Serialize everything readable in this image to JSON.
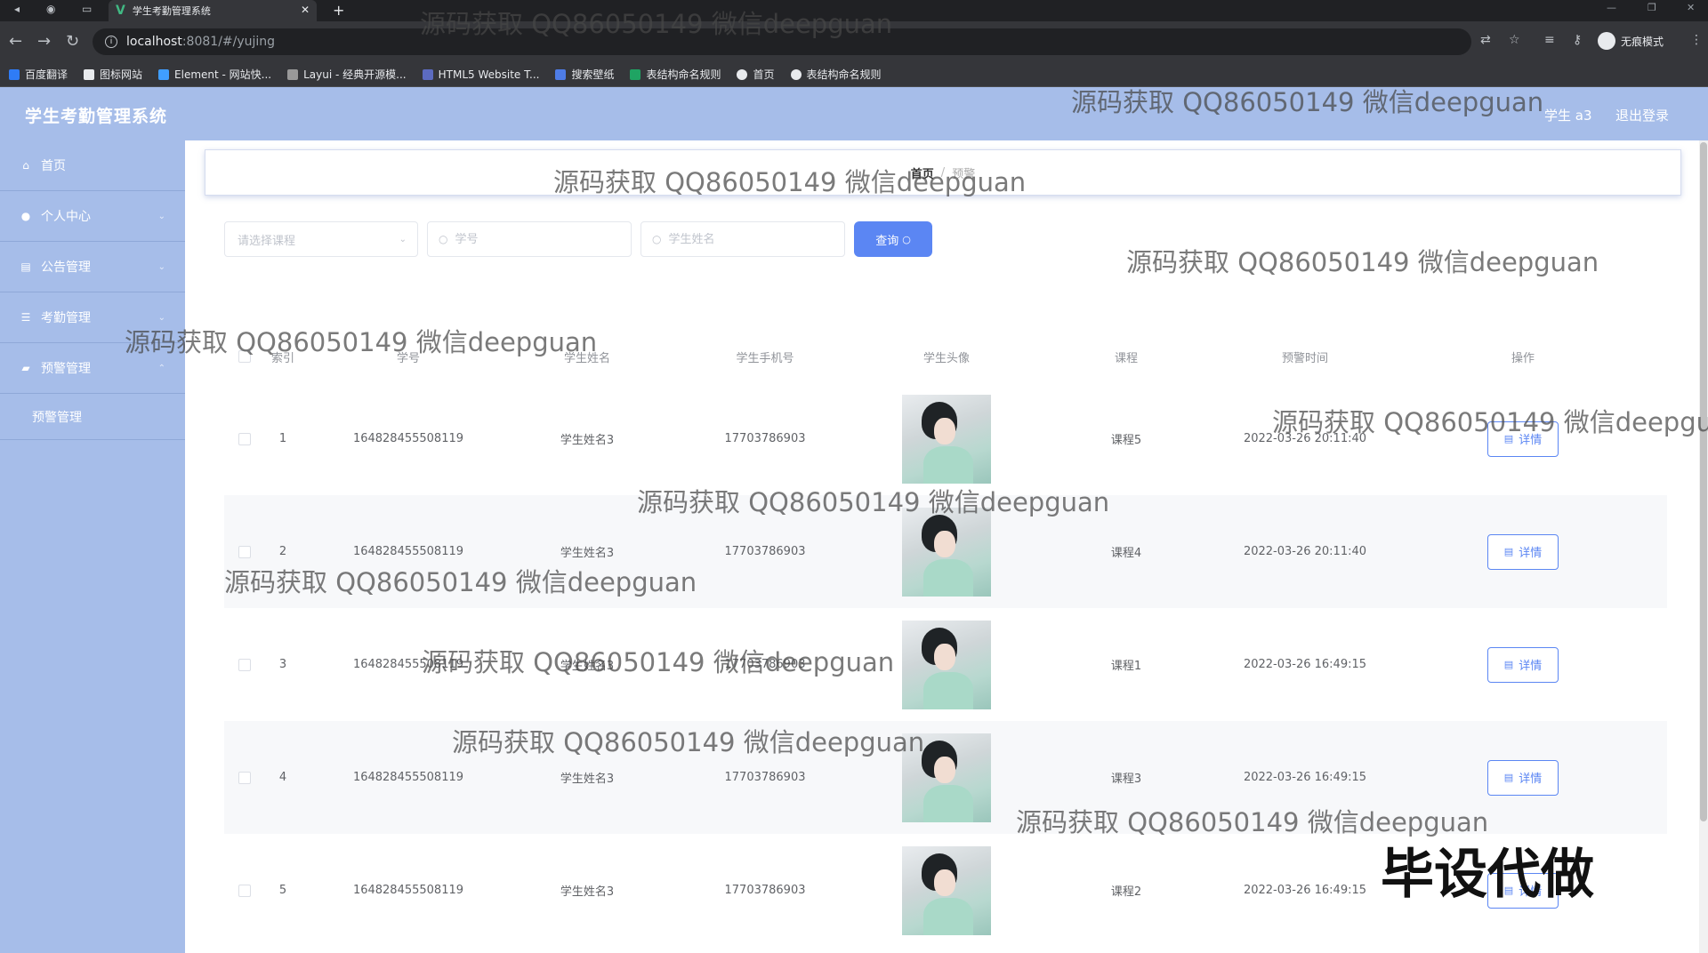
{
  "browser": {
    "tab_title": "学生考勤管理系统",
    "url_host": "localhost",
    "url_path": ":8081/#/yujing",
    "profile_label": "无痕模式",
    "bookmarks": [
      "百度翻译",
      "图标网站",
      "Element - 网站快...",
      "Layui - 经典开源模...",
      "HTML5 Website T...",
      "搜索壁纸",
      "表结构命名规则",
      "首页",
      "表结构命名规则"
    ]
  },
  "header": {
    "title": "学生考勤管理系统",
    "user": "学生 a3",
    "logout": "退出登录"
  },
  "sidebar": {
    "items": [
      {
        "label": "首页",
        "icon": "home-icon"
      },
      {
        "label": "个人中心",
        "icon": "user-icon"
      },
      {
        "label": "公告管理",
        "icon": "list-icon"
      },
      {
        "label": "考勤管理",
        "icon": "menu-icon"
      },
      {
        "label": "预警管理",
        "icon": "folder-icon"
      }
    ],
    "sub_item": "预警管理"
  },
  "breadcrumb": {
    "home": "首页",
    "current": "预警"
  },
  "search": {
    "course_placeholder": "请选择课程",
    "student_no_placeholder": "学号",
    "student_name_placeholder": "学生姓名",
    "query_label": "查询"
  },
  "table": {
    "headers": [
      "索引",
      "学号",
      "学生姓名",
      "学生手机号",
      "学生头像",
      "课程",
      "预警时间",
      "操作"
    ],
    "rows": [
      {
        "index": "1",
        "student_no": "164828455508119",
        "name": "学生姓名3",
        "phone": "17703786903",
        "course": "课程5",
        "time": "2022-03-26 20:11:40"
      },
      {
        "index": "2",
        "student_no": "164828455508119",
        "name": "学生姓名3",
        "phone": "17703786903",
        "course": "课程4",
        "time": "2022-03-26 20:11:40"
      },
      {
        "index": "3",
        "student_no": "164828455508119",
        "name": "学生姓名3",
        "phone": "17703786903",
        "course": "课程1",
        "time": "2022-03-26 16:49:15"
      },
      {
        "index": "4",
        "student_no": "164828455508119",
        "name": "学生姓名3",
        "phone": "17703786903",
        "course": "课程3",
        "time": "2022-03-26 16:49:15"
      },
      {
        "index": "5",
        "student_no": "164828455508119",
        "name": "学生姓名3",
        "phone": "17703786903",
        "course": "课程2",
        "time": "2022-03-26 16:49:15"
      }
    ],
    "detail_label": "详情"
  },
  "watermark": {
    "text": "源码获取 QQ86050149 微信deepguan",
    "banner": "毕设代做"
  }
}
